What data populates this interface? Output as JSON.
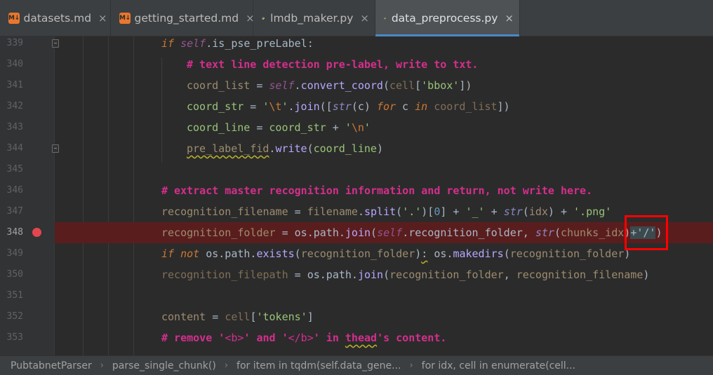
{
  "tabs": [
    {
      "label": "datasets.md",
      "icon": "markdown-icon"
    },
    {
      "label": "getting_started.md",
      "icon": "markdown-icon"
    },
    {
      "label": "lmdb_maker.py",
      "icon": "python-icon"
    },
    {
      "label": "data_preprocess.py",
      "icon": "python-icon"
    }
  ],
  "markdown_icon_text": "M↓",
  "close_glyph": "×",
  "active_tab": "data_preprocess.py",
  "line_numbers": [
    "339",
    "340",
    "341",
    "342",
    "343",
    "344",
    "345",
    "346",
    "347",
    "348",
    "349",
    "350",
    "351",
    "352",
    "353"
  ],
  "breakpoint_line": "348",
  "code": {
    "l339": {
      "a": "if ",
      "b": "self",
      "c": ".is_pse_preLabel:"
    },
    "l340": {
      "a": "# text line detection pre-label, write to txt."
    },
    "l341": {
      "a": "coord_list",
      "b": " = ",
      "c": "self",
      "d": ".",
      "e": "convert_coord",
      "f": "(",
      "g": "cell",
      "h": "[",
      "i": "'bbox'",
      "j": "])"
    },
    "l342": {
      "a": "coord_str",
      "b": " = ",
      "c": "'",
      "d": "\\t",
      "e": "'",
      "f": ".",
      "g": "join",
      "h": "([",
      "i": "str",
      "j": "(c) ",
      "k": "for",
      "l": " c ",
      "m": "in",
      "n": " ",
      "o": "coord_list",
      "p": "])"
    },
    "l343": {
      "a": "coord_line",
      "b": " = ",
      "c": "coord_str",
      "d": " + ",
      "e": "'",
      "f": "\\n",
      "g": "'"
    },
    "l344": {
      "a": "pre_label_fid",
      "b": ".",
      "c": "write",
      "d": "(",
      "e": "coord_line",
      "f": ")"
    },
    "l346": {
      "a": "# extract master recognition information and return, not write here."
    },
    "l347": {
      "a": "recognition_filename",
      "b": " = ",
      "c": "filename",
      "d": ".",
      "e": "split",
      "f": "(",
      "g": "'.'",
      "h": ")[",
      "i": "0",
      "j": "] + ",
      "k": "'_'",
      "l": " + ",
      "m": "str",
      "n": "(",
      "o": "idx",
      "p": ") + ",
      "q": "'.png'"
    },
    "l348": {
      "a": "recognition_folder",
      "b": " = ",
      "c": "os.path.",
      "d": "join",
      "e": "(",
      "f": "self",
      "g": ".recognition_folder, ",
      "h": "str",
      "i": "(",
      "j": "chunks_idx",
      "k": ")",
      "l": "+'/'",
      "m": ")"
    },
    "l349": {
      "a": "if not ",
      "b": "os.path.",
      "c": "exists",
      "d": "(",
      "e": "recognition_folder",
      "f": ")",
      "g": ":",
      "h": " os.",
      "i": "makedirs",
      "j": "(",
      "k": "recognition_folder",
      "l": ")"
    },
    "l350": {
      "a": "recognition_filepath",
      "b": " = ",
      "c": "os.path.",
      "d": "join",
      "e": "(",
      "f": "recognition_folder",
      "g": ", ",
      "h": "recognition_filename",
      "i": ")"
    },
    "l352": {
      "a": "content",
      "b": " = ",
      "c": "cell",
      "d": "[",
      "e": "'tokens'",
      "f": "]"
    },
    "l353": {
      "a": "# remove '",
      "b": "<b>",
      "c": "' and '",
      "d": "</b>",
      "e": "' in ",
      "f": "thead",
      "g": "'s content."
    }
  },
  "breadcrumb": [
    "PubtabnetParser",
    "parse_single_chunk()",
    "for item in tqdm(self.data_gene...",
    "for idx, cell in enumerate(cell..."
  ],
  "breadcrumb_separator": "›",
  "colors": {
    "keyword": "#cc7832",
    "self": "#94558d",
    "comment": "#d32f8d",
    "string": "#6a8759",
    "breakpoint": "#e3464f",
    "breakpoint_line_bg": "#5a1d1d",
    "annotation_box": "#ff0000"
  }
}
